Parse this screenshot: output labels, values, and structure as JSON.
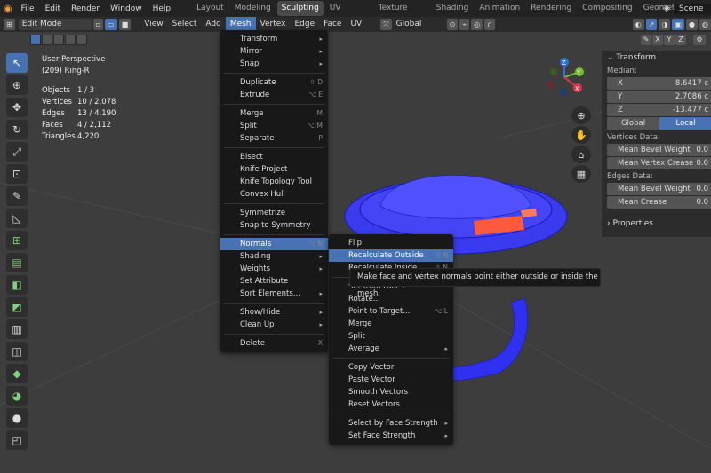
{
  "topbar": {
    "menus": [
      "File",
      "Edit",
      "Render",
      "Window",
      "Help"
    ],
    "workspaces": [
      "Layout",
      "Modeling",
      "Sculpting",
      "UV Editing",
      "Texture Paint",
      "Shading",
      "Animation",
      "Rendering",
      "Compositing",
      "Geometry Nodes"
    ],
    "active_workspace": "Sculpting",
    "scene": "Scene"
  },
  "header": {
    "mode": "Edit Mode",
    "menus": [
      "View",
      "Select",
      "Add",
      "Mesh",
      "Vertex",
      "Edge",
      "Face",
      "UV"
    ],
    "active_menu": "Mesh",
    "orientation": "Global"
  },
  "overlay": {
    "perspective": "User Perspective",
    "object": "(209) Ring-R",
    "stats": [
      {
        "label": "Objects",
        "value": "1 / 3"
      },
      {
        "label": "Vertices",
        "value": "10 / 2,078"
      },
      {
        "label": "Edges",
        "value": "13 / 4,190"
      },
      {
        "label": "Faces",
        "value": "4 / 2,112"
      },
      {
        "label": "Triangles",
        "value": "4,220"
      }
    ]
  },
  "mesh_menu": {
    "groups": [
      [
        {
          "label": "Transform",
          "sub": true
        },
        {
          "label": "Mirror",
          "sub": true
        },
        {
          "label": "Snap",
          "sub": true
        }
      ],
      [
        {
          "label": "Duplicate",
          "shortcut": "⇧ D"
        },
        {
          "label": "Extrude",
          "shortcut": "⌥ E"
        }
      ],
      [
        {
          "label": "Merge",
          "shortcut": "M"
        },
        {
          "label": "Split",
          "shortcut": "⌥ M"
        },
        {
          "label": "Separate",
          "shortcut": "P"
        }
      ],
      [
        {
          "label": "Bisect"
        },
        {
          "label": "Knife Project"
        },
        {
          "label": "Knife Topology Tool"
        },
        {
          "label": "Convex Hull"
        }
      ],
      [
        {
          "label": "Symmetrize"
        },
        {
          "label": "Snap to Symmetry"
        }
      ],
      [
        {
          "label": "Normals",
          "shortcut": "⌥ N",
          "active": true
        },
        {
          "label": "Shading",
          "sub": true
        },
        {
          "label": "Weights",
          "sub": true
        },
        {
          "label": "Set Attribute"
        },
        {
          "label": "Sort Elements...",
          "sub": true
        }
      ],
      [
        {
          "label": "Show/Hide",
          "sub": true
        },
        {
          "label": "Clean Up",
          "sub": true
        }
      ],
      [
        {
          "label": "Delete",
          "shortcut": "X"
        }
      ]
    ]
  },
  "normals_menu": {
    "groups": [
      [
        {
          "label": "Flip"
        },
        {
          "label": "Recalculate Outside",
          "shortcut": "⇧ N",
          "active": true
        },
        {
          "label": "Recalculate Inside",
          "shortcut": "⇧ N"
        }
      ],
      [
        {
          "label": "Set from Faces"
        },
        {
          "label": "Rotate..."
        },
        {
          "label": "Point to Target...",
          "shortcut": "⌥ L"
        },
        {
          "label": "Merge"
        },
        {
          "label": "Split"
        },
        {
          "label": "Average",
          "sub": true
        }
      ],
      [
        {
          "label": "Copy Vector"
        },
        {
          "label": "Paste Vector"
        },
        {
          "label": "Smooth Vectors"
        },
        {
          "label": "Reset Vectors"
        }
      ],
      [
        {
          "label": "Select by Face Strength",
          "sub": true
        },
        {
          "label": "Set Face Strength",
          "sub": true
        }
      ]
    ]
  },
  "tooltip": "Make face and vertex normals point either outside or inside the mesh.",
  "sidebar": {
    "title": "Transform",
    "median_label": "Median:",
    "median": [
      {
        "axis": "X",
        "value": "8.6417 c"
      },
      {
        "axis": "Y",
        "value": "2.7086 c"
      },
      {
        "axis": "Z",
        "value": "-13.477 c"
      }
    ],
    "space": [
      "Global",
      "Local"
    ],
    "active_space": "Local",
    "vertices_label": "Vertices Data:",
    "vertex_fields": [
      {
        "label": "Mean Bevel Weight",
        "value": "0.0"
      },
      {
        "label": "Mean Vertex Crease",
        "value": "0.0"
      }
    ],
    "edges_label": "Edges Data:",
    "edge_fields": [
      {
        "label": "Mean Bevel Weight",
        "value": "0.0"
      },
      {
        "label": "Mean Crease",
        "value": "0.0"
      }
    ],
    "properties": "Properties"
  },
  "colors": {
    "accent": "#4772b3",
    "mesh": "#3030f0",
    "selected_face": "#ff5a3c"
  }
}
